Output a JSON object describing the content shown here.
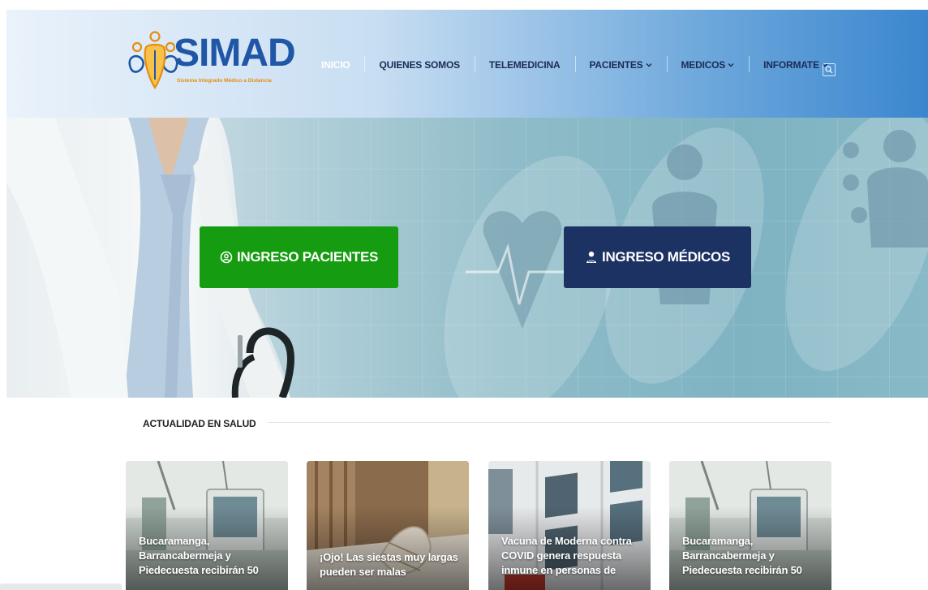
{
  "brand": {
    "name": "SIMAD",
    "tagline": "Sistema Integrado Médico a Distancia",
    "colors": {
      "primary": "#1f57a6",
      "accent": "#e58e10"
    }
  },
  "nav": {
    "items": [
      {
        "label": "INICIO",
        "active": true,
        "has_dropdown": false
      },
      {
        "label": "QUIENES SOMOS",
        "active": false,
        "has_dropdown": false
      },
      {
        "label": "TELEMEDICINA",
        "active": false,
        "has_dropdown": false
      },
      {
        "label": "PACIENTES",
        "active": false,
        "has_dropdown": true
      },
      {
        "label": "MEDICOS",
        "active": false,
        "has_dropdown": true
      },
      {
        "label": "INFORMATE",
        "active": false,
        "has_dropdown": true
      }
    ],
    "search_icon": "search-icon"
  },
  "hero": {
    "patients_button": {
      "label": "INGRESO PACIENTES",
      "icon": "user-circle-icon",
      "color": "#159c10"
    },
    "doctors_button": {
      "label": "INGRESO MÉDICOS",
      "icon": "doctor-icon",
      "color": "#1b3263"
    }
  },
  "news": {
    "section_title": "ACTUALIDAD EN SALUD",
    "cards": [
      {
        "title": "Bucaramanga, Barrancabermeja y Piedecuesta recibirán 50"
      },
      {
        "title": "¡Ojo! Las siestas muy largas pueden ser malas"
      },
      {
        "title": "Vacuna de Moderna contra COVID genera respuesta inmune en personas de"
      },
      {
        "title": "Bucaramanga, Barrancabermeja y Piedecuesta recibirán 50"
      }
    ]
  }
}
